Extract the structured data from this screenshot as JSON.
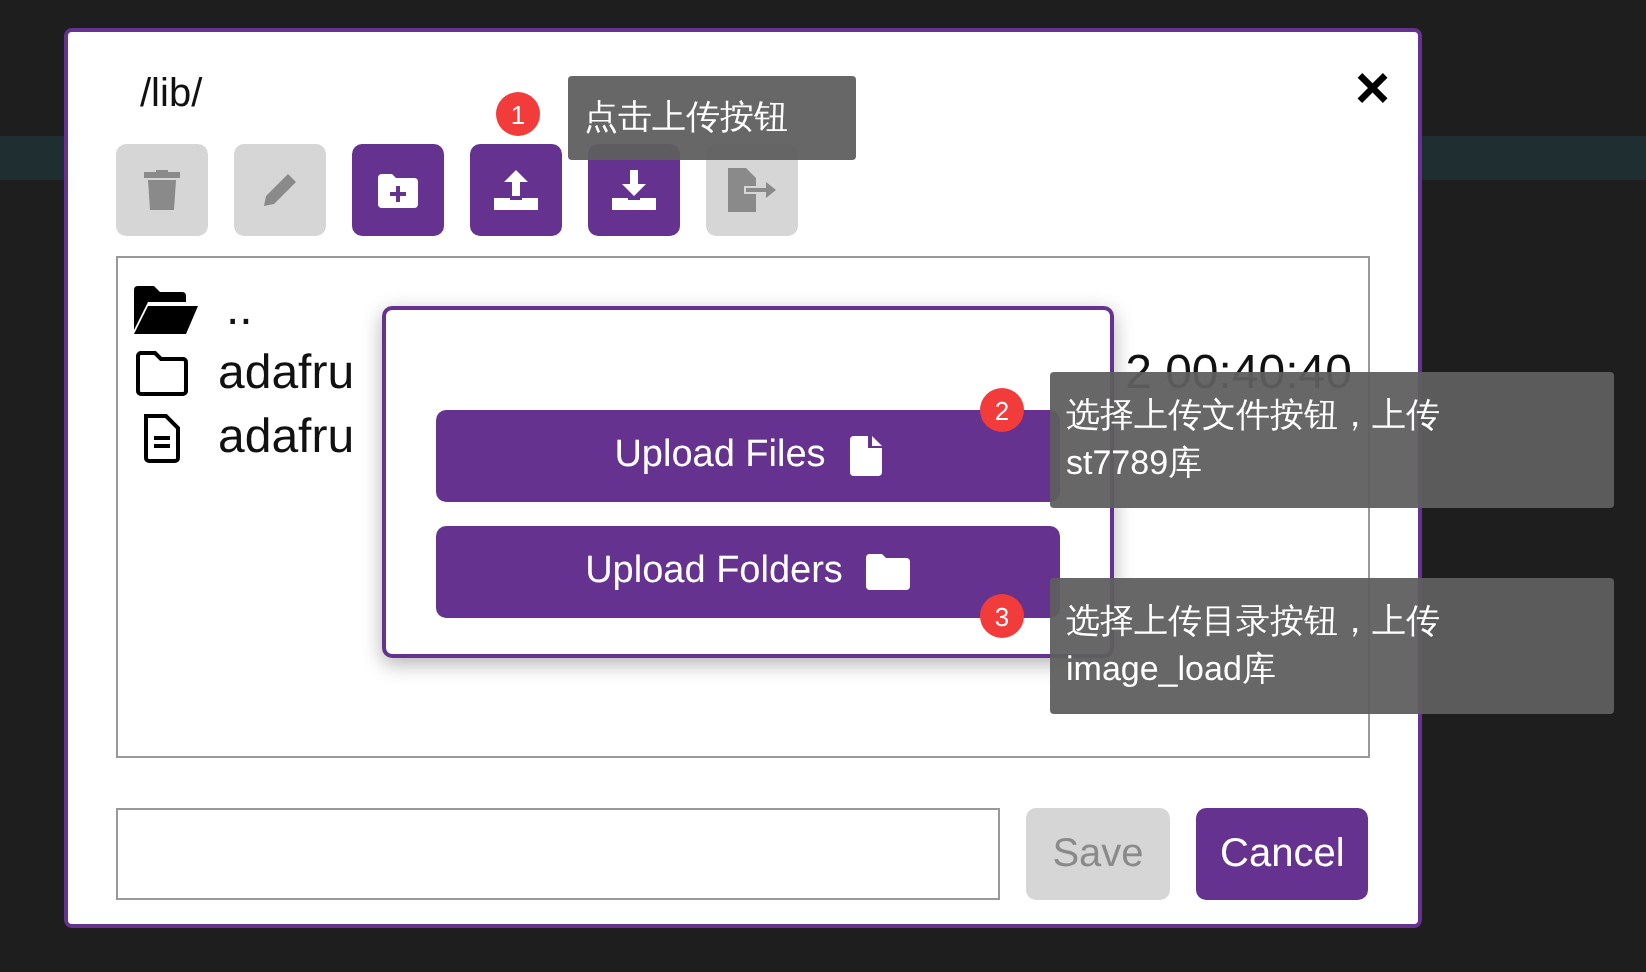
{
  "dialog": {
    "path": "/lib/",
    "close": "×",
    "toolbar": [
      {
        "kind": "delete",
        "disabled": true
      },
      {
        "kind": "rename",
        "disabled": true
      },
      {
        "kind": "new-folder",
        "disabled": false
      },
      {
        "kind": "upload",
        "disabled": false
      },
      {
        "kind": "download",
        "disabled": false
      },
      {
        "kind": "move",
        "disabled": true
      }
    ],
    "files": [
      {
        "kind": "parent",
        "name": ".."
      },
      {
        "kind": "folder",
        "name": "adafru",
        "date": "2 00:40:40"
      },
      {
        "kind": "file",
        "name": "adafru"
      }
    ],
    "buttons": [
      {
        "label": "Save",
        "disabled": true
      },
      {
        "label": "Cancel",
        "disabled": false
      }
    ]
  },
  "upload_menu": [
    {
      "label": "Upload Files",
      "kind": "file"
    },
    {
      "label": "Upload Folders",
      "kind": "folder"
    }
  ],
  "callouts": [
    {
      "number": "1",
      "text": "点击上传按钮"
    },
    {
      "number": "2",
      "text": "选择上传文件按钮，上传st7789库"
    },
    {
      "number": "3",
      "text": "选择上传目录按钮，上传image_load库"
    }
  ]
}
